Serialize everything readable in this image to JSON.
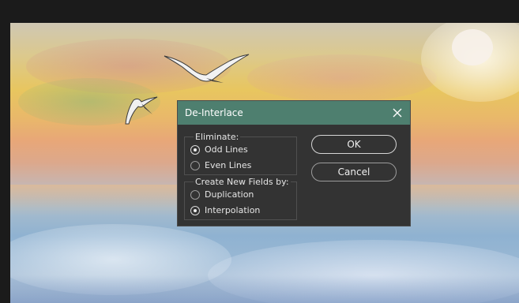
{
  "dialog": {
    "title": "De-Interlace",
    "eliminate": {
      "label": "Eliminate:",
      "options": [
        "Odd Lines",
        "Even Lines"
      ],
      "selected": "Odd Lines"
    },
    "create_fields": {
      "label": "Create New Fields by:",
      "options": [
        "Duplication",
        "Interpolation"
      ],
      "selected": "Interpolation"
    },
    "ok_label": "OK",
    "cancel_label": "Cancel"
  },
  "icons": {
    "close": "close-icon",
    "radio": "radio-button"
  },
  "colors": {
    "titlebar": "#4e7f6f",
    "dialog_bg": "#333333",
    "workspace_bg": "#1b1b1b"
  }
}
